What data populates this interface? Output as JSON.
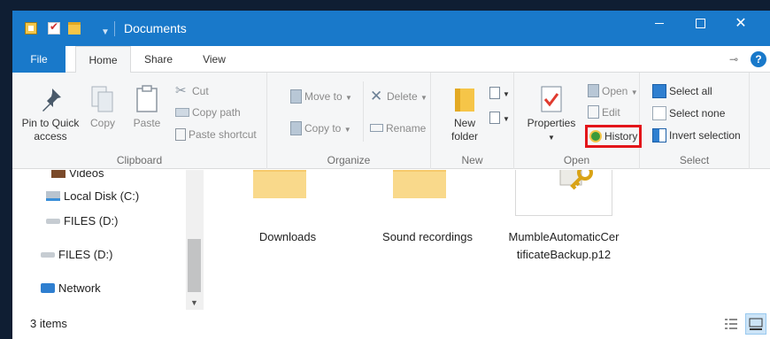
{
  "window": {
    "title": "Documents",
    "minimize_label": "",
    "maximize_label": "",
    "close_label": "✕"
  },
  "tabs": {
    "file": "File",
    "home": "Home",
    "share": "Share",
    "view": "View",
    "help": "?"
  },
  "ribbon": {
    "clipboard": {
      "group_label": "Clipboard",
      "pin_to_quick_access": "Pin to Quick access",
      "copy": "Copy",
      "paste": "Paste",
      "cut": "Cut",
      "copy_path": "Copy path",
      "paste_shortcut": "Paste shortcut"
    },
    "organize": {
      "group_label": "Organize",
      "move_to": "Move to",
      "copy_to": "Copy to",
      "delete": "Delete",
      "rename": "Rename"
    },
    "new": {
      "group_label": "New",
      "new_folder": "New folder"
    },
    "open": {
      "group_label": "Open",
      "properties": "Properties",
      "open": "Open",
      "edit": "Edit",
      "history": "History"
    },
    "select": {
      "group_label": "Select",
      "select_all": "Select all",
      "select_none": "Select none",
      "invert_selection": "Invert selection"
    }
  },
  "nav_pane": {
    "items": [
      {
        "label": "Videos",
        "icon": "videos-folder-icon"
      },
      {
        "label": "Local Disk (C:)",
        "icon": "local-disk-icon"
      },
      {
        "label": "FILES (D:)",
        "icon": "drive-icon"
      },
      {
        "label": "FILES (D:)",
        "icon": "drive-icon"
      },
      {
        "label": "Network",
        "icon": "network-icon"
      }
    ]
  },
  "content": {
    "items": [
      {
        "label": "Downloads",
        "icon": "folder-icon"
      },
      {
        "label": "Sound recordings",
        "icon": "folder-icon"
      },
      {
        "label": "MumbleAutomaticCertificateBackup.p12",
        "icon": "certificate-icon"
      }
    ]
  },
  "status": {
    "count": "3 items"
  },
  "colors": {
    "titlebar": "#1979ca",
    "ribbon_bg": "#f5f6f7",
    "highlight_box": "#e3151a"
  }
}
